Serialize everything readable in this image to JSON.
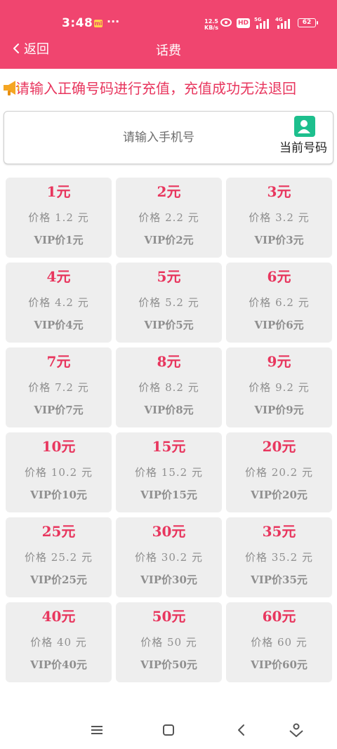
{
  "status_bar": {
    "time": "3:48",
    "net_speed_value": "12.5",
    "net_speed_unit": "KB/s",
    "hd_badge": "HD",
    "signal1_label": "5G",
    "signal2_label": "4G",
    "battery": "62"
  },
  "header": {
    "back_label": "返回",
    "title": "话费",
    "background_color": "#f0456f"
  },
  "notice": {
    "text": "请输入正确号码进行充值，充值成功无法退回",
    "color": "#e8365e"
  },
  "phone_input": {
    "placeholder": "请输入手机号",
    "value": "",
    "current_number_label": "当前号码"
  },
  "recharge_options": [
    {
      "amount": "1元",
      "price": "价格 1.2 元",
      "vip": "VIP价1元"
    },
    {
      "amount": "2元",
      "price": "价格 2.2 元",
      "vip": "VIP价2元"
    },
    {
      "amount": "3元",
      "price": "价格 3.2 元",
      "vip": "VIP价3元"
    },
    {
      "amount": "4元",
      "price": "价格 4.2 元",
      "vip": "VIP价4元"
    },
    {
      "amount": "5元",
      "price": "价格 5.2 元",
      "vip": "VIP价5元"
    },
    {
      "amount": "6元",
      "price": "价格 6.2 元",
      "vip": "VIP价6元"
    },
    {
      "amount": "7元",
      "price": "价格 7.2 元",
      "vip": "VIP价7元"
    },
    {
      "amount": "8元",
      "price": "价格 8.2 元",
      "vip": "VIP价8元"
    },
    {
      "amount": "9元",
      "price": "价格 9.2 元",
      "vip": "VIP价9元"
    },
    {
      "amount": "10元",
      "price": "价格 10.2 元",
      "vip": "VIP价10元"
    },
    {
      "amount": "15元",
      "price": "价格 15.2 元",
      "vip": "VIP价15元"
    },
    {
      "amount": "20元",
      "price": "价格 20.2 元",
      "vip": "VIP价20元"
    },
    {
      "amount": "25元",
      "price": "价格 25.2 元",
      "vip": "VIP价25元"
    },
    {
      "amount": "30元",
      "price": "价格 30.2 元",
      "vip": "VIP价30元"
    },
    {
      "amount": "35元",
      "price": "价格 35.2 元",
      "vip": "VIP价35元"
    },
    {
      "amount": "40元",
      "price": "价格 40 元",
      "vip": "VIP价40元"
    },
    {
      "amount": "50元",
      "price": "价格 50 元",
      "vip": "VIP价50元"
    },
    {
      "amount": "60元",
      "price": "价格 60 元",
      "vip": "VIP价60元"
    }
  ],
  "nav_bar": {
    "icons": [
      "menu-icon",
      "home-icon",
      "back-icon",
      "assistant-icon"
    ]
  }
}
